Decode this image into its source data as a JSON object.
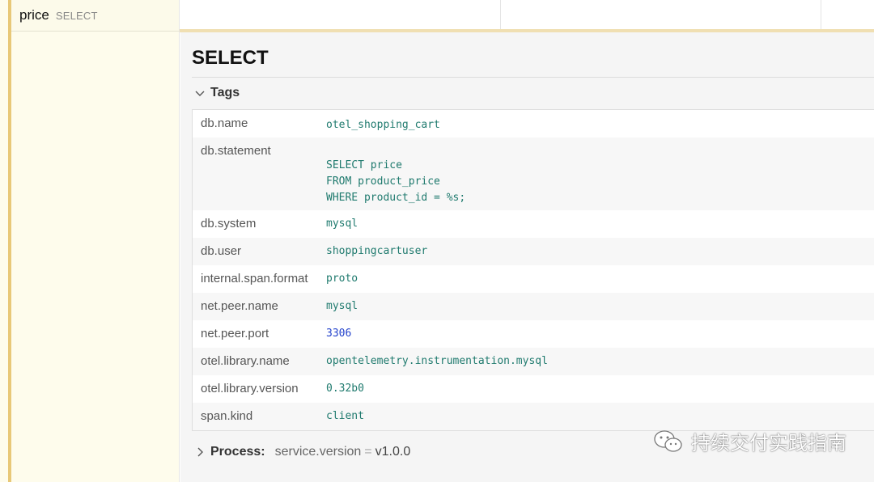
{
  "span": {
    "name": "price",
    "operation": "SELECT"
  },
  "detail": {
    "title": "SELECT",
    "tags_label": "Tags",
    "tags": [
      {
        "key": "db.name",
        "value": "otel_shopping_cart"
      },
      {
        "key": "db.statement",
        "value": "\nSELECT price\nFROM product_price\nWHERE product_id = %s;"
      },
      {
        "key": "db.system",
        "value": "mysql"
      },
      {
        "key": "db.user",
        "value": "shoppingcartuser"
      },
      {
        "key": "internal.span.format",
        "value": "proto"
      },
      {
        "key": "net.peer.name",
        "value": "mysql"
      },
      {
        "key": "net.peer.port",
        "value": "3306"
      },
      {
        "key": "otel.library.name",
        "value": "opentelemetry.instrumentation.mysql"
      },
      {
        "key": "otel.library.version",
        "value": "0.32b0"
      },
      {
        "key": "span.kind",
        "value": "client"
      }
    ],
    "process": {
      "label": "Process:",
      "key": "service.version",
      "eq": "=",
      "value": "v1.0.0"
    }
  },
  "watermark": {
    "text": "持续交付实践指南"
  },
  "colors": {
    "accent": "#e8c878",
    "string_value": "#1f7a6e",
    "number_value": "#2443cc",
    "left_panel_bg": "#fefcec"
  },
  "icons": {
    "collapse": "chevron-down-icon",
    "expand": "chevron-right-icon",
    "wechat": "wechat-icon"
  }
}
